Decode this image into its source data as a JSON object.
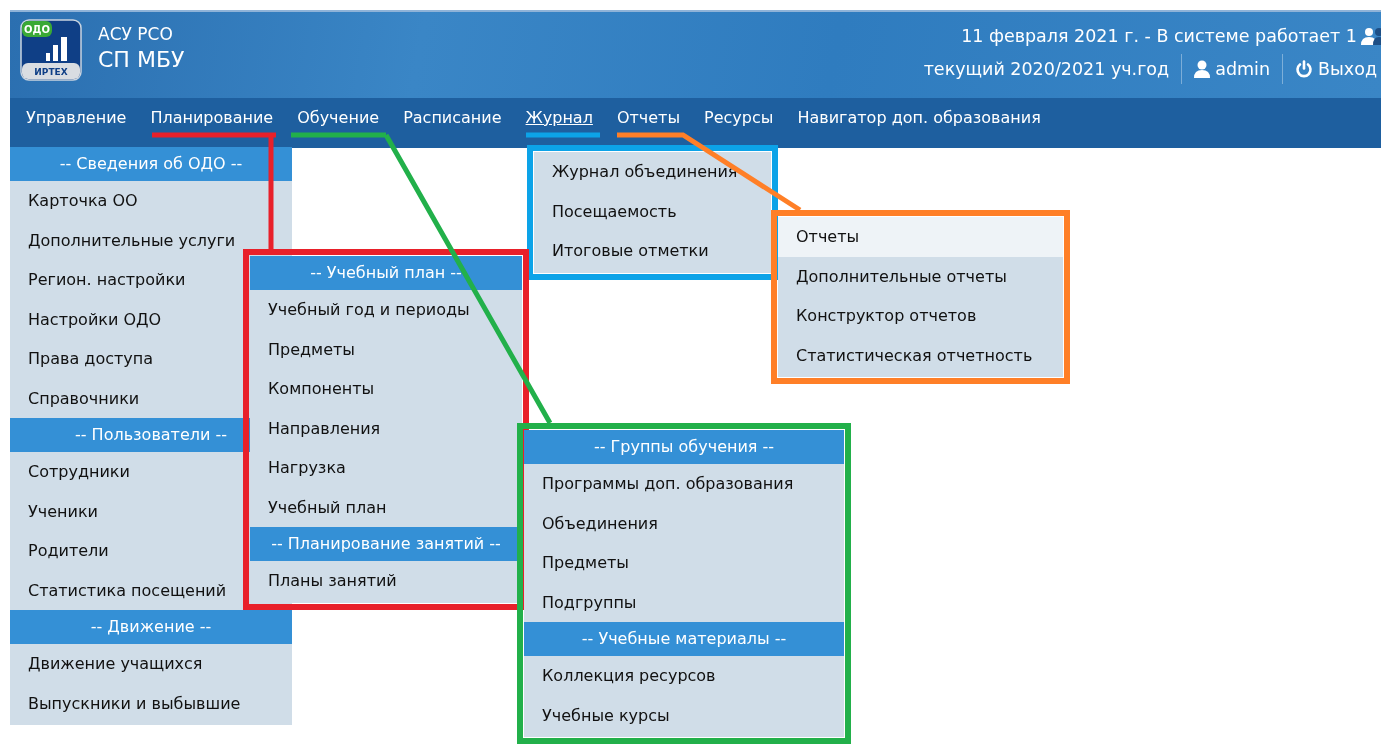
{
  "header": {
    "logo": {
      "badge": "ОДО",
      "brand": "ИРТЕХ"
    },
    "system": "АСУ РСО",
    "organization": "СП МБУ",
    "status": "11 февраля 2021 г. - В системе работает 1",
    "school_year": "текущий 2020/2021 уч.год",
    "user": "admin",
    "logout": "Выход"
  },
  "nav": [
    {
      "label": "Управление",
      "selected": false
    },
    {
      "label": "Планирование",
      "selected": false
    },
    {
      "label": "Обучение",
      "selected": false
    },
    {
      "label": "Расписание",
      "selected": false
    },
    {
      "label": "Журнал",
      "selected": true
    },
    {
      "label": "Отчеты",
      "selected": false
    },
    {
      "label": "Ресурсы",
      "selected": false
    },
    {
      "label": "Навигатор доп. образования",
      "selected": false
    }
  ],
  "dropdowns": [
    {
      "sections": [
        {
          "header": "-- Сведения об ОДО --",
          "items": [
            {
              "label": "Карточка ОО",
              "selected": false
            },
            {
              "label": "Дополнительные услуги",
              "selected": false
            },
            {
              "label": "Регион. настройки",
              "selected": false
            },
            {
              "label": "Настройки ОДО",
              "selected": false
            },
            {
              "label": "Права доступа",
              "selected": false
            },
            {
              "label": "Справочники",
              "selected": false
            }
          ]
        },
        {
          "header": "-- Пользователи --",
          "items": [
            {
              "label": "Сотрудники",
              "selected": false
            },
            {
              "label": "Ученики",
              "selected": false
            },
            {
              "label": "Родители",
              "selected": false
            },
            {
              "label": "Статистика посещений",
              "selected": false
            }
          ]
        },
        {
          "header": "-- Движение --",
          "items": [
            {
              "label": "Движение учащихся",
              "selected": false
            },
            {
              "label": "Выпускники и выбывшие",
              "selected": false
            }
          ]
        }
      ]
    },
    {
      "color": "#0ca3e8",
      "sections": [
        {
          "items": [
            {
              "label": "Журнал объединения",
              "selected": false
            },
            {
              "label": "Посещаемость",
              "selected": false
            },
            {
              "label": "Итоговые отметки",
              "selected": false
            }
          ]
        }
      ]
    },
    {
      "color": "#ff7f27",
      "sections": [
        {
          "items": [
            {
              "label": "Отчеты",
              "selected": true
            },
            {
              "label": "Дополнительные отчеты",
              "selected": false
            },
            {
              "label": "Конструктор отчетов",
              "selected": false
            },
            {
              "label": "Статистическая отчетность",
              "selected": false
            }
          ]
        }
      ]
    },
    {
      "color": "#e8202a",
      "sections": [
        {
          "header": "-- Учебный план --",
          "items": [
            {
              "label": "Учебный год и периоды",
              "selected": false
            },
            {
              "label": "Предметы",
              "selected": false
            },
            {
              "label": "Компоненты",
              "selected": false
            },
            {
              "label": "Направления",
              "selected": false
            },
            {
              "label": "Нагрузка",
              "selected": false
            },
            {
              "label": "Учебный план",
              "selected": false
            }
          ]
        },
        {
          "header": "-- Планирование занятий --",
          "items": [
            {
              "label": "Планы занятий",
              "selected": false
            }
          ]
        }
      ]
    },
    {
      "color": "#22b04a",
      "sections": [
        {
          "header": "-- Группы обучения --",
          "items": [
            {
              "label": "Программы доп. образования",
              "selected": false
            },
            {
              "label": "Объединения",
              "selected": false
            },
            {
              "label": "Предметы",
              "selected": false
            },
            {
              "label": "Подгруппы",
              "selected": false
            }
          ]
        },
        {
          "header": "-- Учебные материалы --",
          "items": [
            {
              "label": "Коллекция ресурсов",
              "selected": false
            },
            {
              "label": "Учебные курсы",
              "selected": false
            }
          ]
        }
      ]
    }
  ]
}
